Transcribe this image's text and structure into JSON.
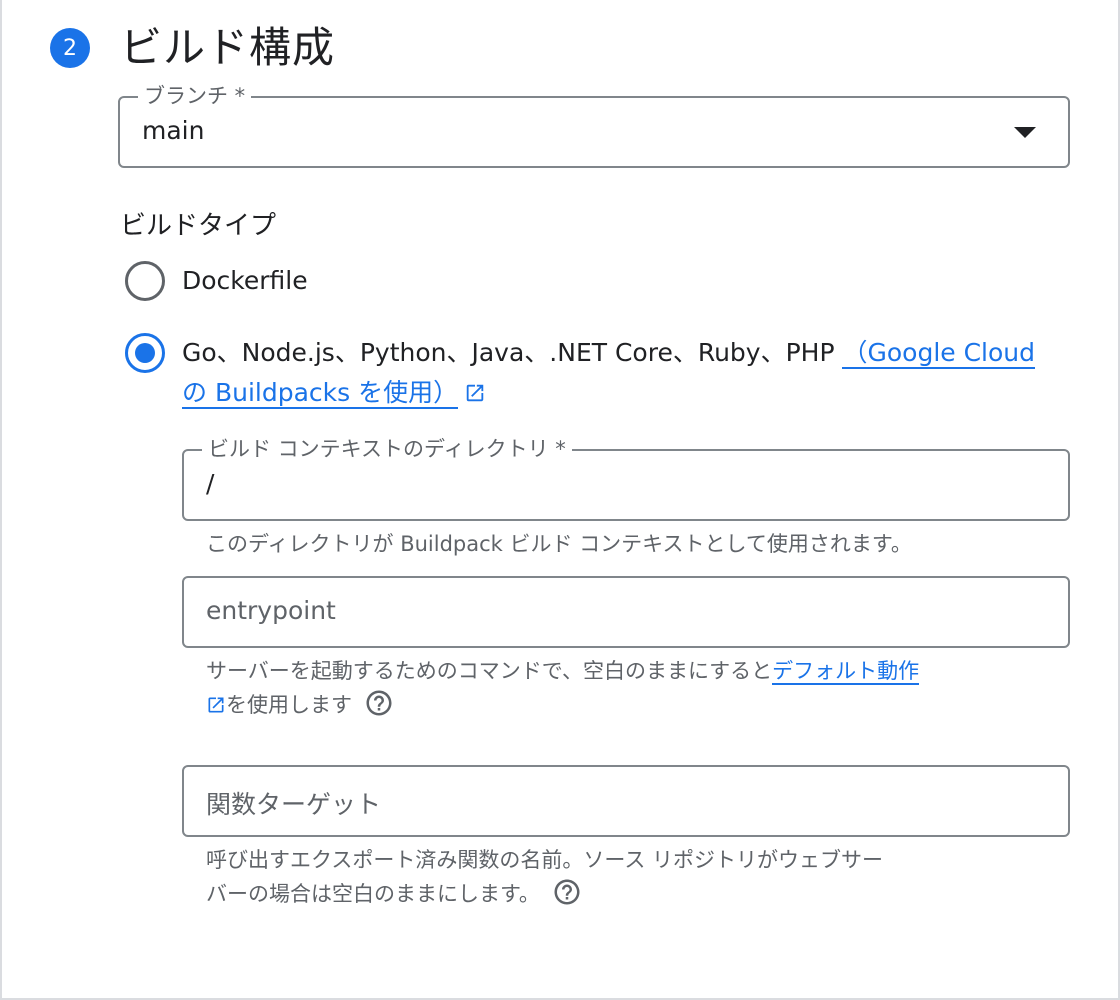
{
  "step": {
    "number": "2",
    "title": "ビルド構成"
  },
  "branch": {
    "label": "ブランチ *",
    "value": "main"
  },
  "build_type": {
    "label": "ビルドタイプ",
    "options": [
      {
        "label": "Dockerfile",
        "selected": false
      },
      {
        "label_prefix": "Go、Node.js、Python、Java、.NET Core、Ruby、PHP ",
        "link_line1": "（Google Cloud",
        "link_line2": "の Buildpacks を使用）",
        "selected": true
      }
    ]
  },
  "context_dir": {
    "label": "ビルド コンテキストのディレクトリ *",
    "value": "/",
    "helper": "このディレクトリが Buildpack ビルド コンテキストとして使用されます。"
  },
  "entrypoint": {
    "placeholder": "entrypoint",
    "helper_prefix": "サーバーを起動するためのコマンドで、空白のままにすると",
    "helper_link": "デフォルト動作",
    "helper_suffix": "を使用します"
  },
  "function_target": {
    "placeholder": "関数ターゲット",
    "helper_line1": "呼び出すエクスポート済み関数の名前。ソース リポジトリがウェブサー",
    "helper_line2": "バーの場合は空白のままにします。"
  },
  "colors": {
    "accent": "#1a73e8",
    "outline": "#80868b",
    "secondary_text": "#5f6368"
  },
  "icons": {
    "external_link": "open-in-new-icon",
    "help": "help-circle-icon",
    "dropdown": "arrow-drop-down-icon"
  }
}
